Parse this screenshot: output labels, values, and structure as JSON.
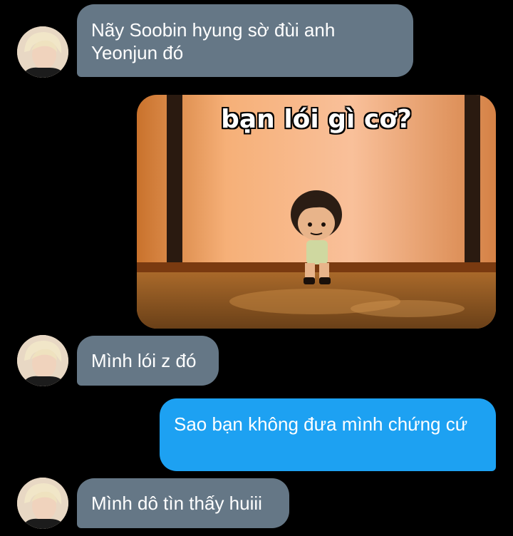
{
  "messages": {
    "m1": "Nãy Soobin hyung sờ đùi anh Yeonjun đó",
    "m2_caption": "bạn lói gì cơ?",
    "m3": "Mình lói z đó",
    "m4": "Sao bạn không đưa mình chứng cứ",
    "m5": "Mình dô tìn thấy huiii"
  },
  "colors": {
    "incoming_bubble": "#657786",
    "outgoing_bubble": "#1da1f2",
    "background": "#000000"
  }
}
